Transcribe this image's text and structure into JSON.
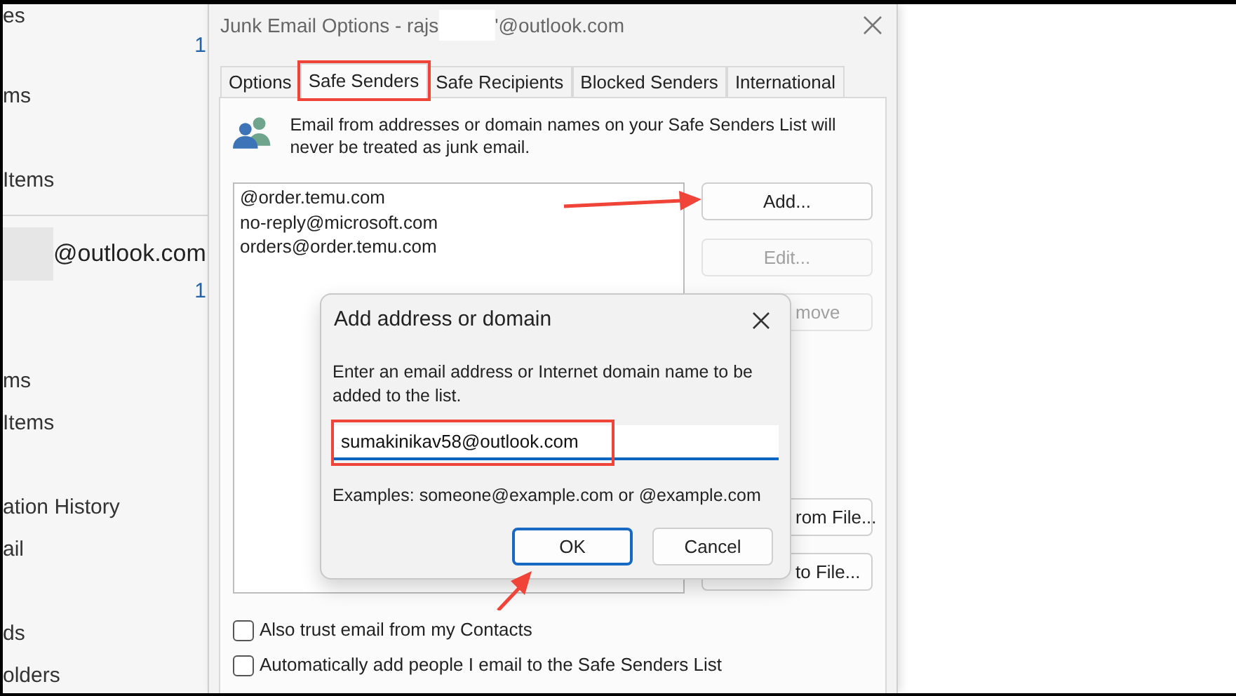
{
  "sidebar": {
    "items": [
      {
        "kind": "folder",
        "label": "es"
      },
      {
        "kind": "count",
        "label": "1"
      },
      {
        "kind": "folder",
        "label": "ms"
      },
      {
        "kind": "folder",
        "label": "Items"
      },
      {
        "kind": "account",
        "label": "@outlook.com"
      },
      {
        "kind": "count",
        "label": "1"
      },
      {
        "kind": "folder",
        "label": "ms"
      },
      {
        "kind": "folder",
        "label": "Items"
      },
      {
        "kind": "folder",
        "label": "ation History"
      },
      {
        "kind": "folder",
        "label": "ail"
      },
      {
        "kind": "folder",
        "label": "ds"
      },
      {
        "kind": "folder",
        "label": "olders"
      }
    ]
  },
  "window": {
    "title": "Junk Email Options - rajs",
    "title_suffix": "'@outlook.com"
  },
  "tabs": [
    {
      "label": "Options",
      "selected": false,
      "highlighted": false
    },
    {
      "label": "Safe Senders",
      "selected": true,
      "highlighted": true
    },
    {
      "label": "Safe Recipients",
      "selected": false,
      "highlighted": false
    },
    {
      "label": "Blocked Senders",
      "selected": false,
      "highlighted": false
    },
    {
      "label": "International",
      "selected": false,
      "highlighted": false
    }
  ],
  "info_text": "Email from addresses or domain names on your Safe Senders List will never be treated as junk email.",
  "safe_senders": [
    "@order.temu.com",
    "no-reply@microsoft.com",
    "orders@order.temu.com"
  ],
  "buttons": [
    {
      "kind": "full",
      "label": "Add...",
      "disabled": false
    },
    {
      "kind": "full",
      "label": "Edit...",
      "disabled": true
    },
    {
      "kind": "partial",
      "label": "move",
      "disabled": true
    },
    {
      "kind": "partial",
      "label": "rom File...",
      "disabled": false
    },
    {
      "kind": "partial",
      "label": "to File...",
      "disabled": false
    }
  ],
  "checkboxes": [
    {
      "label": "Also trust email from my Contacts",
      "checked": false
    },
    {
      "label": "Automatically add people I email to the Safe Senders List",
      "checked": false
    }
  ],
  "modal": {
    "title": "Add address or domain",
    "prompt": "Enter an email address or Internet domain name to be added to the list.",
    "input": {
      "value": "sumakinikav58@outlook.com",
      "highlighted": true
    },
    "examples": "Examples: someone@example.com or @example.com",
    "buttons": [
      {
        "label": "OK",
        "default": true
      },
      {
        "label": "Cancel",
        "default": false
      }
    ]
  }
}
